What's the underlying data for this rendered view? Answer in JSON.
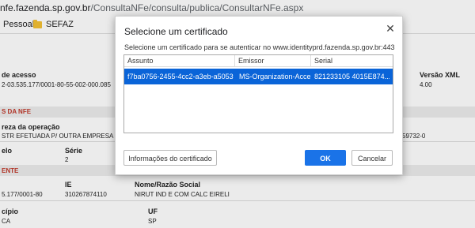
{
  "browser": {
    "url_host": "nfe.fazenda.sp.gov.br",
    "url_path": "/ConsultaNFe/consulta/publica/ConsultarNFe.aspx",
    "bookmarks": [
      "Pessoal",
      "SEFAZ"
    ]
  },
  "page": {
    "chave_label": "de acesso",
    "chave_value": "2-03.535.177/0001-80-55-002-000.085",
    "versao_label": "Versão XML",
    "versao_value": "4.00",
    "section1": "S DA NFE",
    "natureza_label": "reza da operação",
    "natureza_value": "STR EFETUADA P/ OUTRA EMPRESA",
    "natureza_right": "59732-0",
    "modelo_label": "elo",
    "serie_label": "Série",
    "serie_value": "2",
    "section2": "ENTE",
    "cnpj_value": "5.177/0001-80",
    "ie_label": "IE",
    "ie_value": "310267874110",
    "razao_label": "Nome/Razão Social",
    "razao_value": "NIRUT IND E COM CALC EIRELI",
    "municipio_label": "cípio",
    "municipio_value": "CA",
    "uf_label": "UF",
    "uf_value": "SP"
  },
  "dialog": {
    "title": "Selecione um certificado",
    "subtitle": "Selecione um certificado para se autenticar no www.identityprd.fazenda.sp.gov.br:443",
    "columns": [
      "Assunto",
      "Emissor",
      "Serial"
    ],
    "row": {
      "assunto": "f7ba0756-2455-4cc2-a3eb-a5053f8...",
      "emissor": "MS-Organization-Access",
      "serial": "821233105 4015E874..."
    },
    "info_button": "Informações do certificado",
    "ok_button": "OK",
    "cancel_button": "Cancelar"
  }
}
